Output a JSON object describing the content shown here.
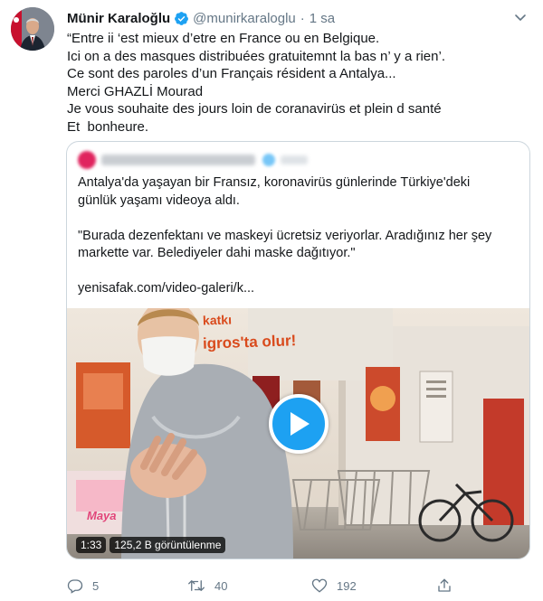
{
  "tweet": {
    "author_name": "Münir Karaloğlu",
    "handle": "@munirkaraloglu",
    "separator": "·",
    "time": "1 sa",
    "lines": [
      "“Entre ii ‘est mieux d’etre en France ou en Belgique.",
      "Ici on a des masques distribuées gratuitemnt la bas n’ y a rien’.",
      "Ce sont des paroles d’un Français résident a Antalya...",
      "Merci GHAZLİ Mourad",
      "Je vous souhaite des jours loin de coranavirüs et plein d santé",
      "Et  bonheure."
    ]
  },
  "quoted": {
    "lines": [
      "Antalya'da yaşayan bir Fransız, koronavirüs günlerinde Türkiye'deki",
      "günlük yaşamı videoya aldı."
    ],
    "quote_lines": [
      "\"Burada dezenfektanı ve maskeyi ücretsiz veriyorlar. Aradığınız her şey",
      "markette var. Belediyeler dahi maske dağıtıyor.\""
    ],
    "link": "yenisafak.com/video-galeri/k...",
    "video": {
      "sign_top": "katkı",
      "sign_main": "igros'ta olur!",
      "box_label": "Maya",
      "duration": "1:33",
      "views": "125,2 B görüntülenme"
    }
  },
  "actions": {
    "reply_count": "5",
    "retweet_count": "40",
    "like_count": "192"
  },
  "colors": {
    "accent": "#1da1f2",
    "muted": "#657786",
    "border": "#ccd6dd"
  }
}
